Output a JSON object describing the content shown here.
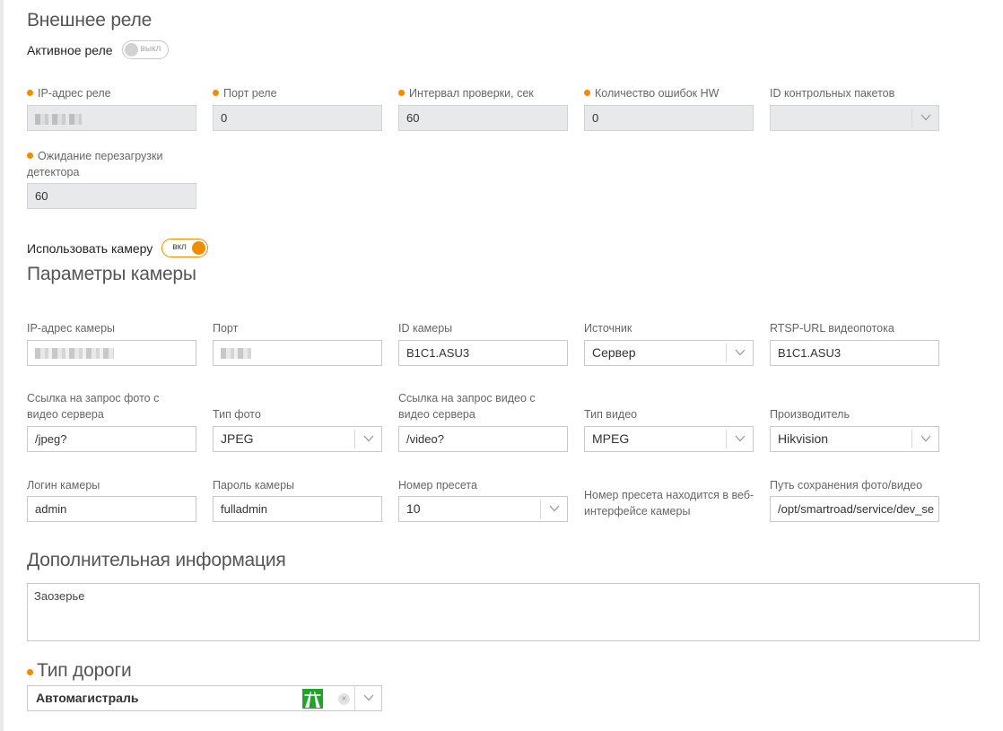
{
  "relay": {
    "title": "Внешнее реле",
    "active_label": "Активное реле",
    "active_switch_text": "выкл",
    "ip_label": "IP-адрес реле",
    "port_label": "Порт реле",
    "port_value": "0",
    "interval_label": "Интервал проверки, сек",
    "interval_value": "60",
    "errors_label": "Количество ошибок HW",
    "errors_value": "0",
    "packets_label": "ID контрольных пакетов",
    "packets_value": "",
    "reboot_label": "Ожидание перезагрузки детектора",
    "reboot_value": "60"
  },
  "camera": {
    "use_label": "Использовать камеру",
    "use_switch_text": "вкл",
    "title": "Параметры камеры",
    "ip_label": "IP-адрес камеры",
    "port_label": "Порт",
    "id_label": "ID камеры",
    "id_value": "B1C1.ASU3",
    "source_label": "Источник",
    "source_value": "Сервер",
    "rtsp_label": "RTSP-URL видеопотока",
    "rtsp_value": "B1C1.ASU3",
    "photo_link_label": "Ссылка на запрос фото с видео сервера",
    "photo_link_value": "/jpeg?",
    "photo_type_label": "Тип фото",
    "photo_type_value": "JPEG",
    "video_link_label": "Ссылка на запрос видео с видео сервера",
    "video_link_value": "/video?",
    "video_type_label": "Тип видео",
    "video_type_value": "MPEG",
    "vendor_label": "Производитель",
    "vendor_value": "Hikvision",
    "login_label": "Логин камеры",
    "login_value": "admin",
    "password_label": "Пароль камеры",
    "password_value": "fulladmin",
    "preset_label": "Номер пресета",
    "preset_value": "10",
    "preset_hint": "Номер пресета находится в веб-интерфейсе камеры",
    "save_path_label": "Путь сохранения фото/видео",
    "save_path_value": "/opt/smartroad/service/dev_se"
  },
  "extra": {
    "title": "Дополнительная информация",
    "value": "Заозерье"
  },
  "road": {
    "title": "Тип дороги",
    "value": "Автомагистраль",
    "clear_symbol": "×"
  },
  "colors": {
    "accent": "#f08c00",
    "road_icon": "#1fa52a",
    "disabled_bg": "#e8e9eb"
  }
}
